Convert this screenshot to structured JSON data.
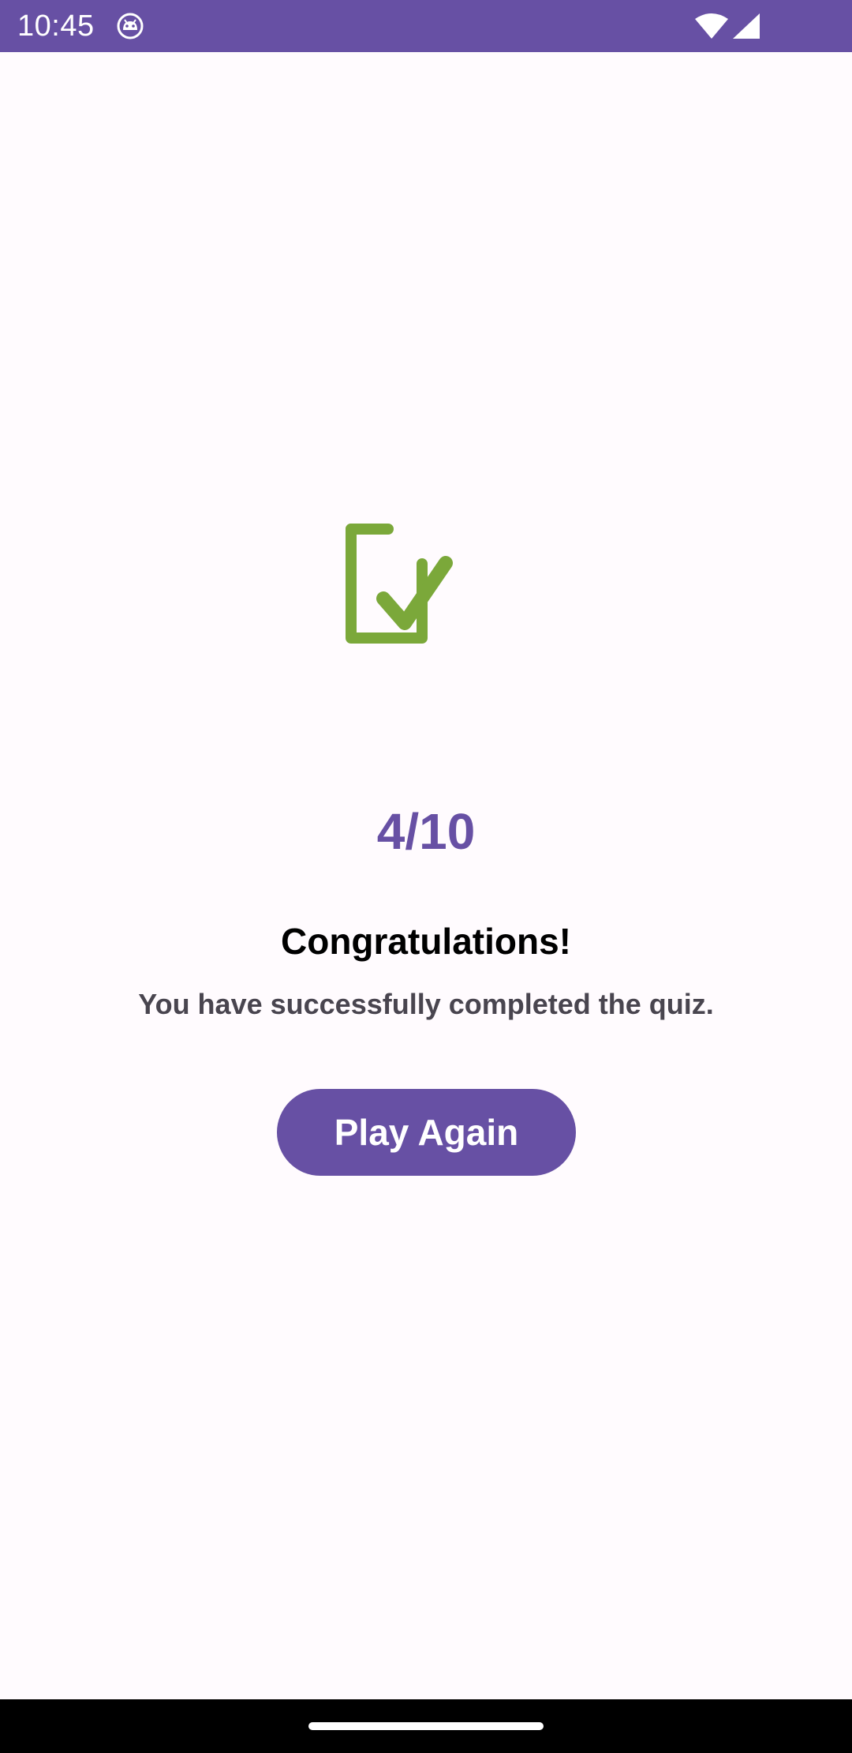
{
  "status_bar": {
    "time": "10:45",
    "app_icon": "android-debug-icon",
    "wifi_icon": "wifi-icon",
    "signal_icon": "cell-signal-icon",
    "background": "#6750A4"
  },
  "result": {
    "icon": "checkbox-checked-icon",
    "icon_color": "#7BA83A",
    "score": "4/10",
    "heading": "Congratulations!",
    "message": "You have successfully completed the quiz.",
    "play_again_label": "Play Again",
    "accent_color": "#6750A4"
  },
  "nav_bar": {
    "home_handle": "gesture-nav-handle"
  }
}
